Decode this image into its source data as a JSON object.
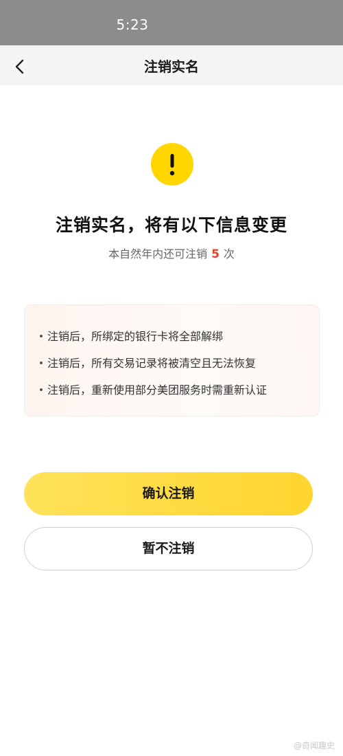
{
  "status_bar": {
    "time": "5:23"
  },
  "nav": {
    "title": "注销实名",
    "back_icon": "chevron-left-icon"
  },
  "hero": {
    "icon": "exclamation-icon",
    "icon_color": "#ffd600",
    "title": "注销实名，将有以下信息变更",
    "subtitle_prefix": "本自然年内还可注销",
    "remaining_count": "5",
    "subtitle_suffix": "次",
    "count_color": "#e8412c"
  },
  "notice": {
    "items": [
      "注销后，所绑定的银行卡将全部解绑",
      "注销后，所有交易记录将被清空且无法恢复",
      "注销后，重新使用部分美团服务时需重新认证"
    ]
  },
  "actions": {
    "confirm_label": "确认注销",
    "cancel_label": "暂不注销",
    "accent_color": "#ffd52e"
  },
  "watermark": {
    "text": "@奇闻趣史"
  }
}
